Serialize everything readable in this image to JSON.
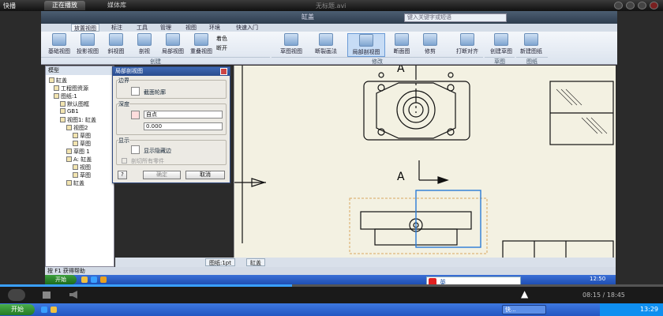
{
  "player": {
    "logo": "快播",
    "tabs": [
      "正在播放",
      "媒体库"
    ],
    "title": "无标题.avi",
    "time": "08:15 / 18:45",
    "progress": 0.44
  },
  "inventor": {
    "doc_title": "缸盖",
    "search_placeholder": "键入关键字或短语",
    "ribbon_tabs": [
      "放置视图",
      "标注",
      "工具",
      "管理",
      "视图",
      "环境",
      "快速入门"
    ],
    "buttons": [
      {
        "label": "基础视图"
      },
      {
        "label": "投影视图"
      },
      {
        "label": "斜视图"
      },
      {
        "label": "剖视"
      },
      {
        "label": "局部视图"
      },
      {
        "label": "重叠视图"
      },
      {
        "label": "草图视图"
      },
      {
        "label": "断裂画法"
      },
      {
        "label": "局部剖视图"
      },
      {
        "label": "断面图"
      },
      {
        "label": "修剪"
      },
      {
        "label": "打断对齐"
      },
      {
        "label": "创建草图"
      },
      {
        "label": "新建图纸"
      }
    ],
    "small_buttons": [
      "着色",
      "断开"
    ],
    "groups": [
      "创建",
      "修改",
      "草图",
      "图纸"
    ],
    "browser_header": "模型",
    "tree": [
      "缸盖",
      "工程图资源",
      "图纸:1",
      "默认图框",
      "GB1",
      "视图1: 缸盖",
      "视图2",
      "草图",
      "草图",
      "草图 1",
      "A: 缸盖",
      "视图",
      "草图",
      "缸盖"
    ],
    "sheet_tabs": [
      "图纸:1pt",
      "缸盖"
    ],
    "status": "按 F1 获得帮助",
    "section_label": "A"
  },
  "dialog": {
    "title": "局部剖视图",
    "boundary_label": "边界",
    "boundary_value": "截面轮廓",
    "depth_label": "深度",
    "depth_mode": "自点",
    "depth_value": "0.000",
    "display_label": "显示",
    "show_hidden": "显示隐藏边",
    "cut_all": "剖切所有零件",
    "ok": "确定",
    "cancel": "取消",
    "help": "?"
  },
  "taskbar": {
    "start": "开始",
    "start_outer": "开始",
    "ime_label": "英",
    "clock_inner": "12:50",
    "clock_outer": "13:29",
    "task_label": "快..."
  }
}
